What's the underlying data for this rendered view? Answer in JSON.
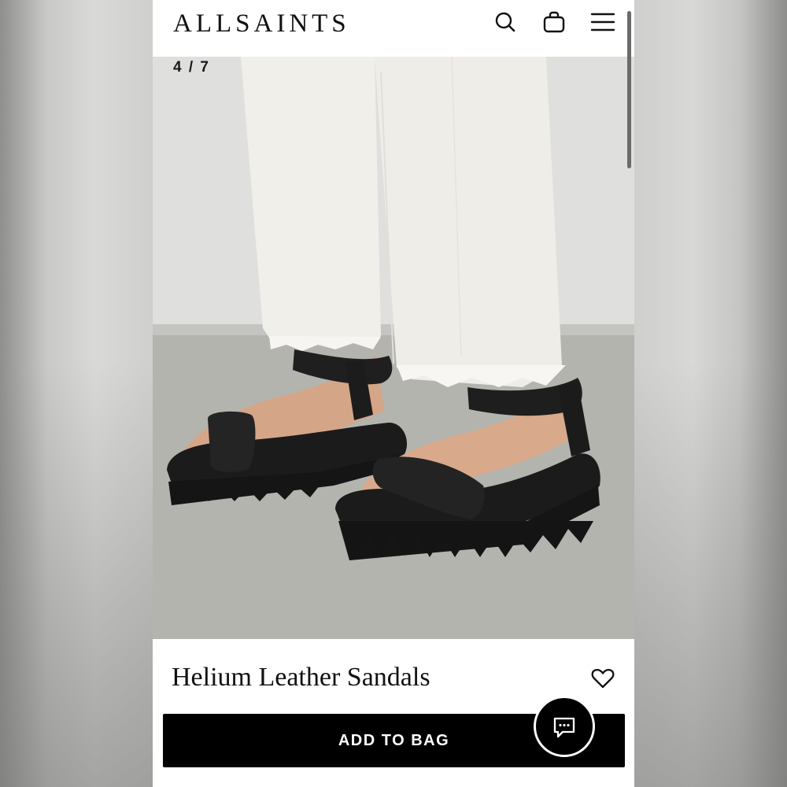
{
  "header": {
    "brand": "ALLSAINTS",
    "icons": [
      "search-icon",
      "bag-icon",
      "menu-icon"
    ]
  },
  "gallery": {
    "counter": "4 / 7"
  },
  "product": {
    "name": "Helium Leather Sandals",
    "add_to_bag_label": "ADD TO BAG"
  },
  "colors": {
    "primary": "#000000",
    "background": "#ffffff"
  }
}
